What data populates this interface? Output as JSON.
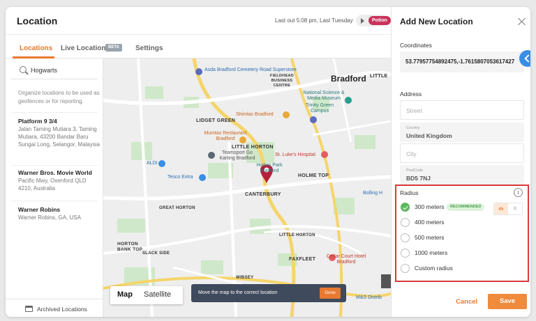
{
  "app": {
    "title": "Location",
    "last_out": "Last out 5:08 pm, Last Tuesday",
    "user_badge": "Potion"
  },
  "tabs": [
    {
      "label": "Locations"
    },
    {
      "label": "Live Locations",
      "badge": "BETA"
    },
    {
      "label": "Settings"
    }
  ],
  "sidebar": {
    "search_value": "Hogwarts",
    "hint": "Organize locations to be used as geofences or for reporting.",
    "locations": [
      {
        "name": "Platform 9 3/4",
        "address": "Jalan Taming Mutiara 3, Taming Mutiara, 43200 Bandar Baru Sungai Long, Selangor, Malaysia"
      },
      {
        "name": "Warner Bros. Movie World",
        "address": "Pacific Mwy, Oxenford QLD 4210, Australia"
      },
      {
        "name": "Warner Robins",
        "address": "Warner Robins, GA, USA"
      }
    ],
    "archived_label": "Archived Locations"
  },
  "map": {
    "labels": {
      "asda": "Asda Bradford Cemetery Road Superstore",
      "fieldhead": "FIELDHEAD BUSINESS CENTRE",
      "bradford": "Bradford",
      "little": "LITTLE",
      "national": "National Science & Media Museum",
      "trinity": "Trinity Green Campus",
      "shimlas": "Shimlas Bradford",
      "lidget": "LIDGET GREEN",
      "mumtaz": "Mumtaz Restaurant Bradford",
      "little_horton": "LITTLE HORTON",
      "teamsport": "Teamsport Go Karting Bradford",
      "stlukes": "St. Luke's Hospital",
      "aldi": "ALDI",
      "horton_park": "Horton Park Bradford",
      "holme": "HOLME TOP",
      "tesco": "Tesco Extra",
      "canterbury": "CANTERBURY",
      "great_horton": "GREAT HORTON",
      "little_horton_2": "LITTLE HORTON",
      "horton_bank": "HORTON BANK TOP",
      "slack_side": "SLACK SIDE",
      "wibsey": "WIBSEY",
      "faxfleet": "FAXFLEET",
      "cedar": "Cedar Court Hotel Bradford",
      "msdistrib": "M&S Distrib",
      "bolling": "Bolling H"
    },
    "toggle": {
      "map": "Map",
      "satellite": "Satellite"
    },
    "toast": "Move the map to the correct location",
    "done_label": "Done"
  },
  "panel": {
    "title": "Add New Location",
    "coordinates_label": "Coordinates",
    "coordinates_value": "53.77957754892475,-1.7615807053617427",
    "address_label": "Address",
    "street_placeholder": "Street",
    "country_label": "Country",
    "country_value": "United Kingdom",
    "city_placeholder": "City",
    "postcode_label": "PostCode",
    "postcode_value": "BD5 7NJ",
    "radius_label": "Radius",
    "radius_options": [
      {
        "label": "300 meters",
        "badge": "RECOMMENDED",
        "selected": true
      },
      {
        "label": "400 meters",
        "selected": false
      },
      {
        "label": "500 meters",
        "selected": false
      },
      {
        "label": "1000 meters",
        "selected": false
      },
      {
        "label": "Custom radius",
        "selected": false
      }
    ],
    "units": {
      "m": "m",
      "ft": "ft",
      "selected": "m"
    },
    "cancel_label": "Cancel",
    "save_label": "Save"
  },
  "colors": {
    "accent": "#e8792f",
    "primary_blue": "#3a8ee6",
    "success": "#5cb85c",
    "highlight_border": "#d83a3a",
    "pin": "#b5203b"
  }
}
